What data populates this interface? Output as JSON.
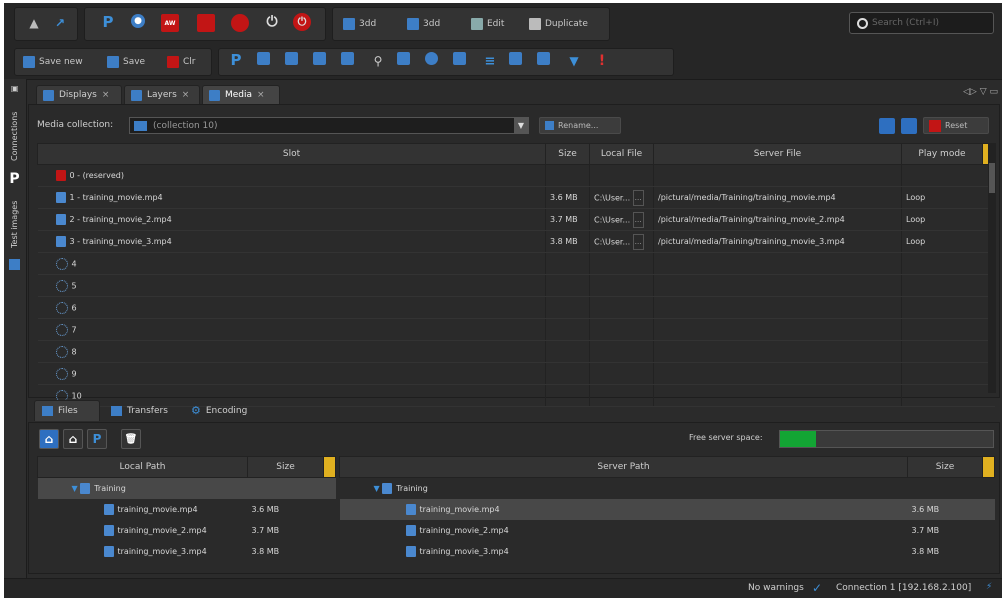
{
  "toolbar1": {
    "icons": [
      "pin-icon",
      "share-icon",
      "p-logo-icon",
      "globe-icon",
      "alert-icon",
      "stop-icon",
      "record-icon",
      "power-icon",
      "emergency-icon"
    ],
    "add_3d_label": "3dd",
    "add_2d_label": "3dd",
    "edit_label": "Edit",
    "duplicate_label": "Duplicate",
    "search_placeholder": "Search (Ctrl+I)"
  },
  "toolbar2": {
    "save_new_label": "Save new",
    "save_label": "Save",
    "cb_label": "Clr"
  },
  "sidebar": {
    "connections_label": "Connections",
    "p_label": "P",
    "test_images_label": "Test images"
  },
  "tabs": [
    {
      "label": "Displays",
      "close": "×"
    },
    {
      "label": "Layers",
      "close": "×"
    },
    {
      "label": "Media",
      "close": "×"
    }
  ],
  "media": {
    "collection_label": "Media collection:",
    "collection_value": "(collection 10)",
    "rename_label": "Rename...",
    "reset_label": "Reset",
    "columns": [
      "Slot",
      "Size",
      "Local File",
      "Server File",
      "Play mode"
    ],
    "rows": [
      {
        "slot": "0 - (reserved)",
        "size": "",
        "local": "",
        "server": "",
        "mode": "",
        "kind": "reserved"
      },
      {
        "slot": "1 - training_movie.mp4",
        "size": "3.6 MB",
        "local": "C:\\User...",
        "server": "/pictural/media/Training/training_movie.mp4",
        "mode": "Loop",
        "kind": "file"
      },
      {
        "slot": "2 - training_movie_2.mp4",
        "size": "3.7 MB",
        "local": "C:\\User...",
        "server": "/pictural/media/Training/training_movie_2.mp4",
        "mode": "Loop",
        "kind": "file"
      },
      {
        "slot": "3 - training_movie_3.mp4",
        "size": "3.8 MB",
        "local": "C:\\User...",
        "server": "/pictural/media/Training/training_movie_3.mp4",
        "mode": "Loop",
        "kind": "file"
      },
      {
        "slot": "4",
        "kind": "empty"
      },
      {
        "slot": "5",
        "kind": "empty"
      },
      {
        "slot": "6",
        "kind": "empty"
      },
      {
        "slot": "7",
        "kind": "empty"
      },
      {
        "slot": "8",
        "kind": "empty"
      },
      {
        "slot": "9",
        "kind": "empty"
      },
      {
        "slot": "10",
        "kind": "empty"
      }
    ]
  },
  "bottom_tabs": [
    "Files",
    "Transfers",
    "Encoding"
  ],
  "files": {
    "free_space_label": "Free server space:",
    "free_space_fraction": 0.17,
    "local_columns": [
      "Local Path",
      "Size"
    ],
    "server_columns": [
      "Server Path",
      "Size"
    ],
    "local_rows": [
      {
        "name": "Training",
        "size": "",
        "folder": true
      },
      {
        "name": "training_movie.mp4",
        "size": "3.6 MB",
        "folder": false
      },
      {
        "name": "training_movie_2.mp4",
        "size": "3.7 MB",
        "folder": false
      },
      {
        "name": "training_movie_3.mp4",
        "size": "3.8 MB",
        "folder": false
      }
    ],
    "server_rows": [
      {
        "name": "Training",
        "size": "",
        "folder": true
      },
      {
        "name": "training_movie.mp4",
        "size": "3.6 MB",
        "folder": false
      },
      {
        "name": "training_movie_2.mp4",
        "size": "3.7 MB",
        "folder": false
      },
      {
        "name": "training_movie_3.mp4",
        "size": "3.8 MB",
        "folder": false
      }
    ]
  },
  "status": {
    "warnings": "No warnings",
    "connection": "Connection 1 [192.168.2.100]"
  }
}
